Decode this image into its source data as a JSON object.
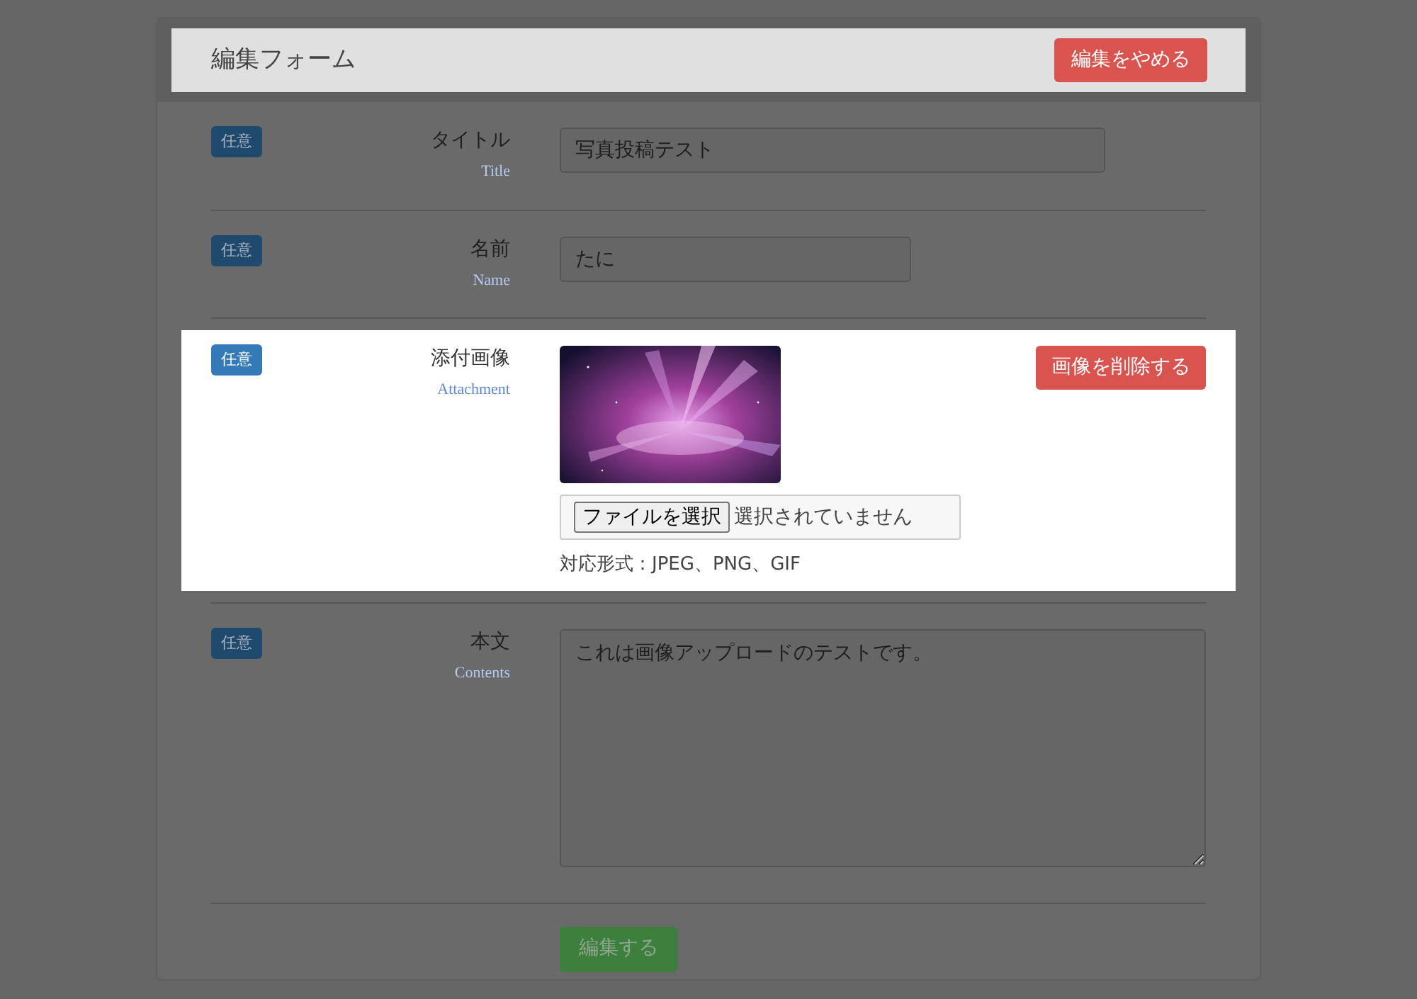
{
  "header": {
    "title": "編集フォーム",
    "highlighted": true,
    "cancel_button": "編集をやめる"
  },
  "rows": [
    {
      "kind": "text",
      "badge": "任意",
      "label": "タイトル",
      "sublabel": "Title",
      "value": "写真投稿テスト",
      "highlighted": false
    },
    {
      "kind": "text_short",
      "badge": "任意",
      "label": "名前",
      "sublabel": "Name",
      "value": "たに",
      "highlighted": false
    },
    {
      "kind": "file",
      "badge": "任意",
      "label": "添付画像",
      "sublabel": "Attachment",
      "file_button": "ファイルを選択",
      "file_status": "選択されていません",
      "hint": "対応形式：JPEG、PNG、GIF",
      "delete_button": "画像を削除する",
      "highlighted": true
    },
    {
      "kind": "textarea",
      "badge": "任意",
      "label": "本文",
      "sublabel": "Contents",
      "value": "これは画像アップロードのテストです。",
      "highlighted": false
    }
  ],
  "submit_button": "編集する"
}
